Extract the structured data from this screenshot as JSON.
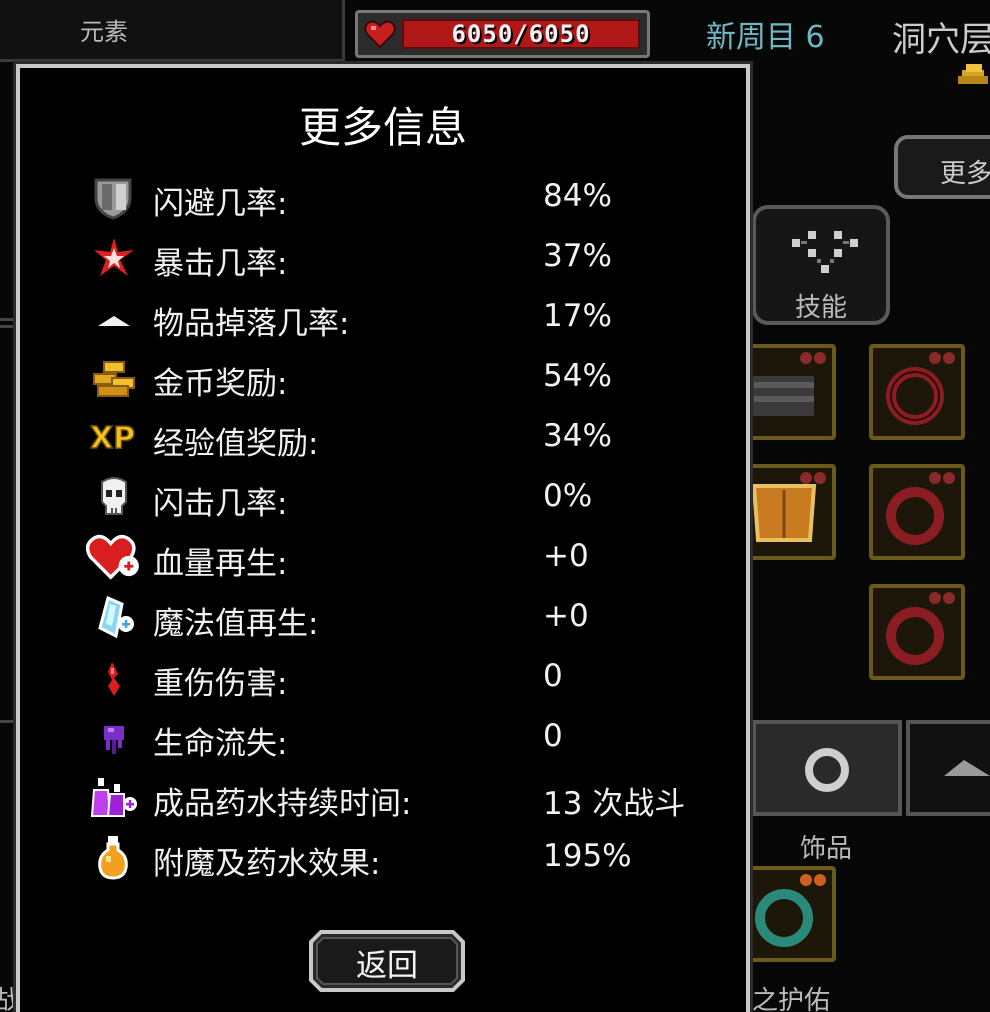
{
  "header": {
    "element_tab_label": "元素",
    "hp_text": "6050/6050",
    "new_cycle_label": "新周目 6",
    "location_partial": "洞穴层",
    "more_button_label": "更多",
    "skills_button_label": "技能"
  },
  "equipment": {
    "accessory_tab_label": "饰品",
    "protection_label_partial": "之护佑",
    "left_edge_char": "战"
  },
  "modal": {
    "title": "更多信息",
    "stats": [
      {
        "icon": "shield-icon",
        "label": "闪避几率:",
        "value": "84%"
      },
      {
        "icon": "crit-spark-icon",
        "label": "暴击几率:",
        "value": "37%"
      },
      {
        "icon": "item-pile-icon",
        "label": "物品掉落几率:",
        "value": "17%"
      },
      {
        "icon": "gold-coins-icon",
        "label": "金币奖励:",
        "value": "54%"
      },
      {
        "icon": "xp-icon",
        "label": "经验值奖励:",
        "value": "34%"
      },
      {
        "icon": "skull-icon",
        "label": "闪击几率:",
        "value": "0%"
      },
      {
        "icon": "heart-plus-icon",
        "label": "血量再生:",
        "value": "+0"
      },
      {
        "icon": "mana-crystal-icon",
        "label": "魔法值再生:",
        "value": "+0"
      },
      {
        "icon": "blood-drop-icon",
        "label": "重伤伤害:",
        "value": "0"
      },
      {
        "icon": "poison-drip-icon",
        "label": "生命流失:",
        "value": "0"
      },
      {
        "icon": "potions-plus-icon",
        "label": "成品药水持续时间:",
        "value": "13 次战斗"
      },
      {
        "icon": "orange-potion-icon",
        "label": "附魔及药水效果:",
        "value": "195%"
      }
    ],
    "back_button_label": "返回",
    "xp_icon_text": "XP"
  },
  "colors": {
    "hp_red": "#b01818",
    "new_cycle_teal": "#6fb7c2",
    "slot_gold": "#6a5a1c",
    "modal_border": "#c9c9c9"
  }
}
